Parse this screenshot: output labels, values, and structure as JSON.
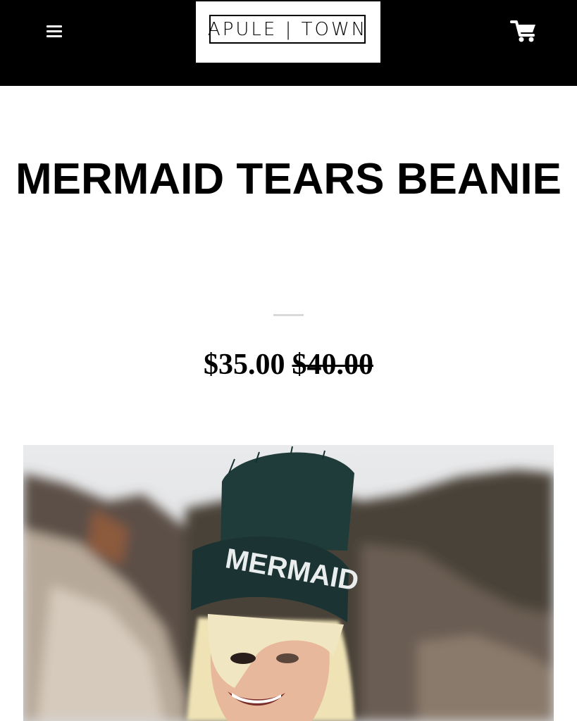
{
  "header": {
    "logo_text": "APULE | TOWN",
    "menu_icon": "hamburger-menu-icon",
    "cart_icon": "shopping-cart-icon"
  },
  "product": {
    "title": "MERMAID TEARS BEANIE",
    "price_sale": "$35.00",
    "price_original": "$40.00",
    "image_hat_text": "MERMAID"
  },
  "colors": {
    "header_bg": "#000000",
    "beanie": "#1f3c3b",
    "hair": "#efe3b6"
  }
}
